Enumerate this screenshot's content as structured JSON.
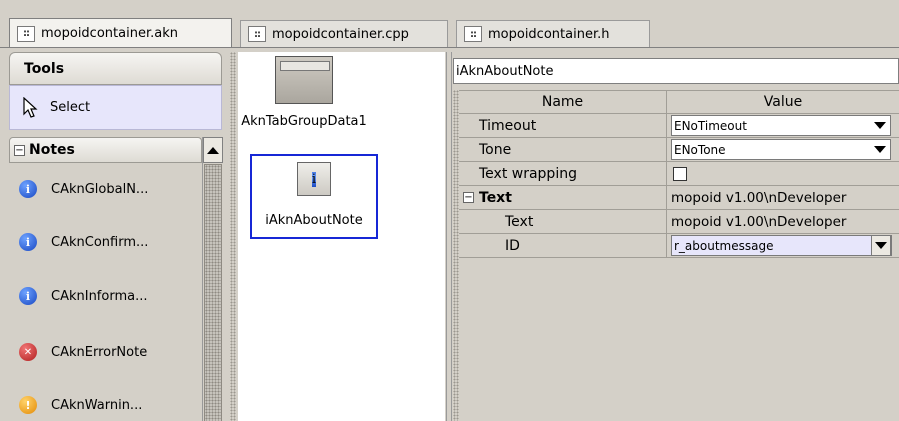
{
  "tabs": [
    {
      "label": "mopoidcontainer.akn",
      "active": true
    },
    {
      "label": "mopoidcontainer.cpp",
      "active": false
    },
    {
      "label": "mopoidcontainer.h",
      "active": false
    }
  ],
  "palette": {
    "header": "Tools",
    "select_label": "Select",
    "notes_header": "Notes",
    "notes_items": [
      {
        "label": "CAknGlobalN...",
        "icon": "info-icon"
      },
      {
        "label": "CAknConfirm...",
        "icon": "info-icon"
      },
      {
        "label": "CAknInforma...",
        "icon": "info-icon"
      },
      {
        "label": "CAknErrorNote",
        "icon": "error-icon"
      },
      {
        "label": "CAknWarnin...",
        "icon": "warning-icon"
      }
    ]
  },
  "canvas": {
    "components": [
      {
        "label": "AknTabGroupData1"
      },
      {
        "label": "iAknAboutNote"
      }
    ]
  },
  "properties": {
    "title": "iAknAboutNote",
    "col_name": "Name",
    "col_value": "Value",
    "rows": [
      {
        "name": "Timeout",
        "value": "ENoTimeout"
      },
      {
        "name": "Tone",
        "value": "ENoTone"
      },
      {
        "name": "Text wrapping",
        "value": ""
      },
      {
        "name": "Text",
        "value": "mopoid v1.00\\nDeveloper"
      },
      {
        "name": "Text",
        "value": "mopoid v1.00\\nDeveloper"
      },
      {
        "name": "ID",
        "value": "r_aboutmessage"
      }
    ]
  }
}
